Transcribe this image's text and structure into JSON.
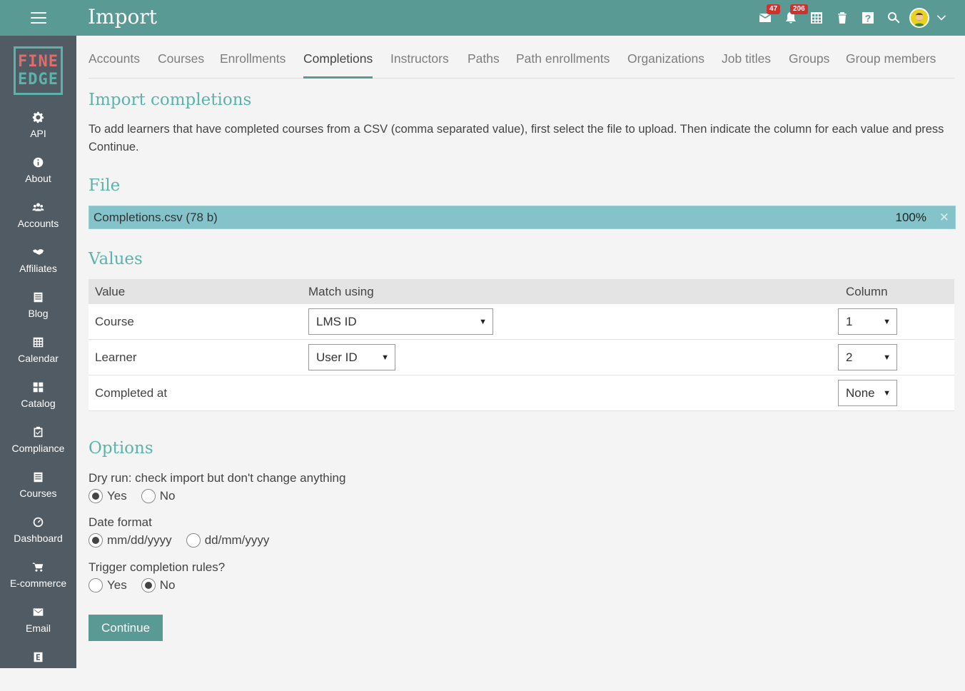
{
  "header": {
    "title": "Import",
    "mail_badge": "47",
    "notifications_badge": "206"
  },
  "sidebar": {
    "logo_line1": "FINE",
    "logo_line2": "EDGE",
    "items": [
      {
        "label": "API",
        "icon": "gear-icon"
      },
      {
        "label": "About",
        "icon": "info-icon"
      },
      {
        "label": "Accounts",
        "icon": "users-icon"
      },
      {
        "label": "Affiliates",
        "icon": "handshake-icon"
      },
      {
        "label": "Blog",
        "icon": "blog-icon"
      },
      {
        "label": "Calendar",
        "icon": "calendar-icon"
      },
      {
        "label": "Catalog",
        "icon": "grid-icon"
      },
      {
        "label": "Compliance",
        "icon": "checklist-icon"
      },
      {
        "label": "Courses",
        "icon": "courses-icon"
      },
      {
        "label": "Dashboard",
        "icon": "dashboard-icon"
      },
      {
        "label": "E-commerce",
        "icon": "cart-icon"
      },
      {
        "label": "Email",
        "icon": "mail-icon"
      }
    ]
  },
  "tabs": [
    {
      "label": "Accounts"
    },
    {
      "label": "Courses"
    },
    {
      "label": "Enrollments"
    },
    {
      "label": "Completions"
    },
    {
      "label": "Instructors"
    },
    {
      "label": "Paths"
    },
    {
      "label": "Path enrollments"
    },
    {
      "label": "Organizations"
    },
    {
      "label": "Job titles"
    },
    {
      "label": "Groups"
    },
    {
      "label": "Group members"
    }
  ],
  "main": {
    "heading": "Import completions",
    "description": "To add learners that have completed courses from a CSV (comma separated value), first select the file to upload. Then indicate the column for each value and press Continue.",
    "file_heading": "File",
    "file_name": "Completions.csv (78 b)",
    "file_progress": "100%",
    "file_progress_value": 1.0,
    "values_heading": "Values",
    "table_headers": {
      "value": "Value",
      "match": "Match using",
      "column": "Column"
    },
    "rows": [
      {
        "value": "Course",
        "match": "LMS ID",
        "column": "1"
      },
      {
        "value": "Learner",
        "match": "User ID",
        "column": "2"
      },
      {
        "value": "Completed at",
        "match": "",
        "column": "None"
      }
    ],
    "options_heading": "Options",
    "dry_run_label": "Dry run: check import but don't change anything",
    "dry_run_yes": "Yes",
    "dry_run_no": "No",
    "date_format_label": "Date format",
    "date_format_1": "mm/dd/yyyy",
    "date_format_2": "dd/mm/yyyy",
    "trigger_label": "Trigger completion rules?",
    "trigger_yes": "Yes",
    "trigger_no": "No",
    "continue_label": "Continue"
  },
  "colors": {
    "topbar": "#5a9a94",
    "sidebar": "#515b63",
    "accent": "#5ab4ab",
    "progress": "#84c3c9",
    "badge": "#d0312d"
  }
}
